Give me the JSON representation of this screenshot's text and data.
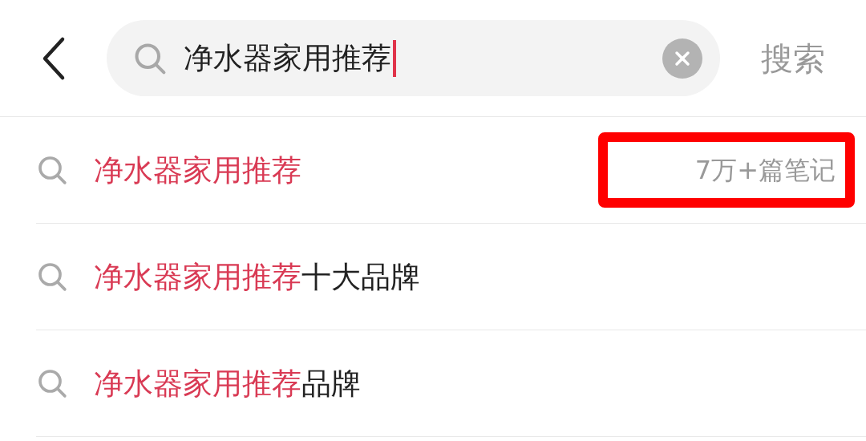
{
  "search": {
    "value": "净水器家用推荐",
    "submit": "搜索"
  },
  "suggestions": [
    {
      "match": "净水器家用推荐",
      "count": "7万+篇笔记",
      "highlighted": true
    },
    {
      "match": "净水器家用推荐",
      "rest": "十大品牌"
    },
    {
      "match": "净水器家用推荐",
      "rest": "品牌"
    }
  ]
}
